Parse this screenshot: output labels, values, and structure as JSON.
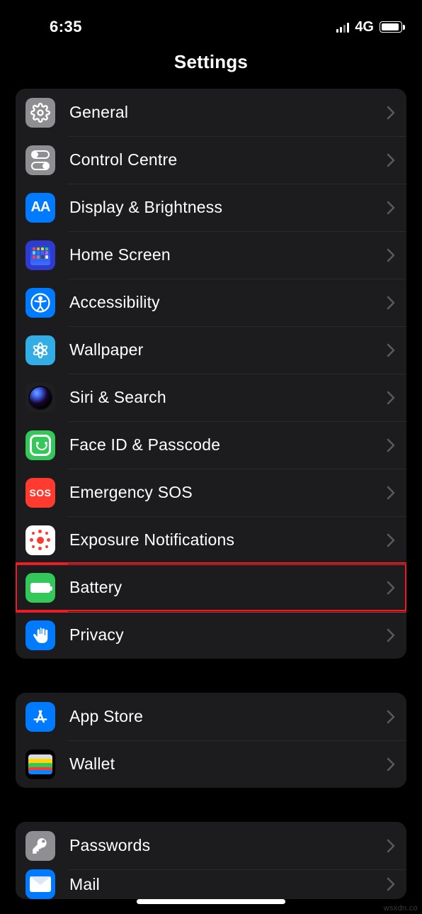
{
  "statusbar": {
    "time": "6:35",
    "network": "4G"
  },
  "page_title": "Settings",
  "groups": [
    {
      "rows": [
        {
          "key": "general",
          "label": "General"
        },
        {
          "key": "control_centre",
          "label": "Control Centre"
        },
        {
          "key": "display_brightness",
          "label": "Display & Brightness"
        },
        {
          "key": "home_screen",
          "label": "Home Screen"
        },
        {
          "key": "accessibility",
          "label": "Accessibility"
        },
        {
          "key": "wallpaper",
          "label": "Wallpaper"
        },
        {
          "key": "siri_search",
          "label": "Siri & Search"
        },
        {
          "key": "faceid_passcode",
          "label": "Face ID & Passcode"
        },
        {
          "key": "emergency_sos",
          "label": "Emergency SOS",
          "sos_text": "SOS"
        },
        {
          "key": "exposure_notifications",
          "label": "Exposure Notifications"
        },
        {
          "key": "battery",
          "label": "Battery",
          "highlighted": true
        },
        {
          "key": "privacy",
          "label": "Privacy"
        }
      ]
    },
    {
      "rows": [
        {
          "key": "app_store",
          "label": "App Store"
        },
        {
          "key": "wallet",
          "label": "Wallet"
        }
      ]
    },
    {
      "rows": [
        {
          "key": "passwords",
          "label": "Passwords"
        },
        {
          "key": "mail",
          "label": "Mail"
        }
      ]
    }
  ],
  "aa_text": "AA",
  "watermark": "wsxdn.co"
}
